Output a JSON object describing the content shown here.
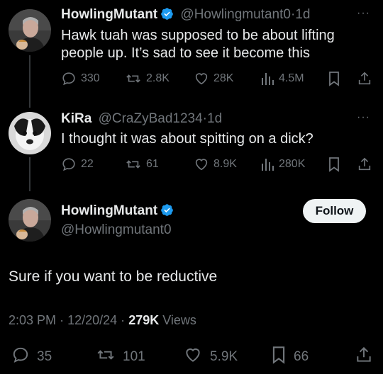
{
  "tweets": [
    {
      "name": "HowlingMutant",
      "handle": "@Howlingmutant0",
      "time": "1d",
      "text_line1": "Hawk tuah was supposed to be about lifting",
      "text_line2": "people up. It’s sad to see it become this",
      "replies": "330",
      "retweets": "2.8K",
      "likes": "28K",
      "views": "4.5M"
    },
    {
      "name": "KiRa",
      "handle": "@CraZyBad1234",
      "time": "1d",
      "text_line1": "I thought it was about spitting on a dick?",
      "replies": "22",
      "retweets": "61",
      "likes": "8.9K",
      "views": "280K"
    }
  ],
  "main": {
    "name": "HowlingMutant",
    "handle": "@Howlingmutant0",
    "follow_label": "Follow",
    "text": "Sure if you want to be reductive",
    "time": "2:03 PM",
    "date": "12/20/24",
    "views_count": "279K",
    "views_label": "Views",
    "replies": "35",
    "retweets": "101",
    "likes": "5.9K",
    "bookmarks": "66"
  },
  "separator": "·",
  "more_icon": "···",
  "colors": {
    "verified": "#1d9bf0",
    "muted": "#71767b",
    "text": "#e7e9ea",
    "background": "#000000"
  }
}
